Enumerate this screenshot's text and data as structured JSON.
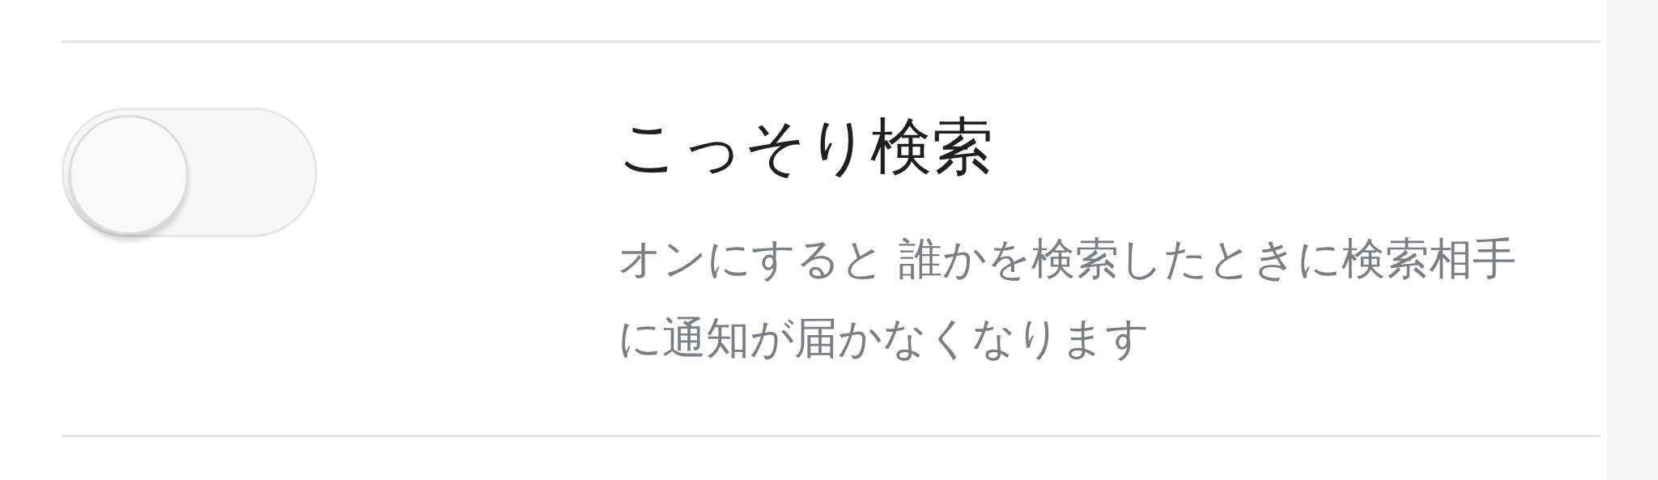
{
  "setting": {
    "title": "こっそり検索",
    "description": "オンにすると 誰かを検索したときに検索相手に通知が届かなくなります",
    "on": false
  }
}
